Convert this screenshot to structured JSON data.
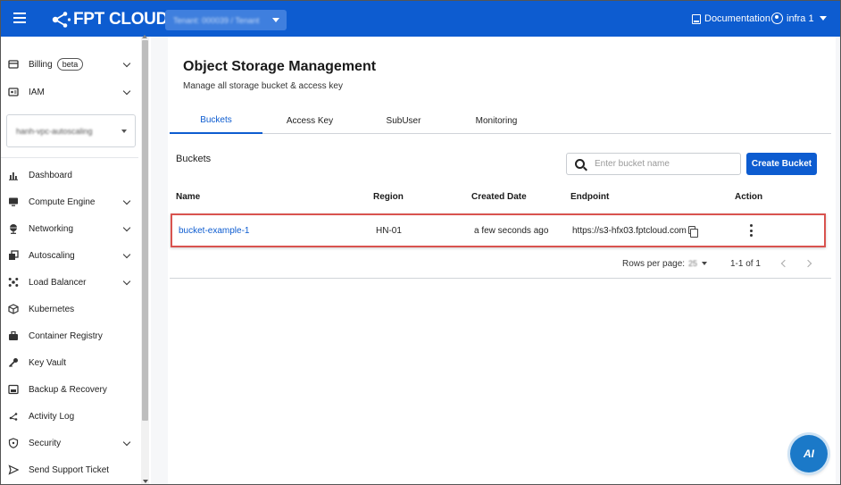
{
  "header": {
    "brand": "FPT CLOUD",
    "tenant_label": "Tenant: 000039 / Tenant",
    "documentation": "Documentation",
    "user": "infra 1"
  },
  "sidebar": {
    "top_items": [
      {
        "label": "Billing",
        "badge": "beta",
        "icon": "billing-icon",
        "expandable": true
      },
      {
        "label": "IAM",
        "icon": "iam-icon",
        "expandable": true
      }
    ],
    "vpc_select": "hanh-vpc-autoscaling",
    "items": [
      {
        "label": "Dashboard",
        "icon": "dashboard-icon",
        "expandable": false
      },
      {
        "label": "Compute Engine",
        "icon": "monitor-icon",
        "expandable": true
      },
      {
        "label": "Networking",
        "icon": "globe-icon",
        "expandable": true
      },
      {
        "label": "Autoscaling",
        "icon": "autoscaling-icon",
        "expandable": true
      },
      {
        "label": "Load Balancer",
        "icon": "load-balancer-icon",
        "expandable": true
      },
      {
        "label": "Kubernetes",
        "icon": "cube-icon",
        "expandable": false
      },
      {
        "label": "Container Registry",
        "icon": "registry-icon",
        "expandable": false
      },
      {
        "label": "Key Vault",
        "icon": "key-icon",
        "expandable": false
      },
      {
        "label": "Backup & Recovery",
        "icon": "backup-icon",
        "expandable": false
      },
      {
        "label": "Activity Log",
        "icon": "activity-icon",
        "expandable": false
      },
      {
        "label": "Security",
        "icon": "shield-icon",
        "expandable": true
      },
      {
        "label": "Send Support Ticket",
        "icon": "send-icon",
        "expandable": false
      }
    ]
  },
  "main": {
    "title": "Object Storage Management",
    "subtitle": "Manage all storage bucket & access key",
    "tabs": [
      "Buckets",
      "Access Key",
      "SubUser",
      "Monitoring"
    ],
    "active_tab": "Buckets",
    "section_title": "Buckets",
    "search_placeholder": "Enter bucket name",
    "create_button": "Create Bucket",
    "table": {
      "headers": [
        "Name",
        "Region",
        "Created Date",
        "Endpoint",
        "Action"
      ],
      "rows": [
        {
          "name": "bucket-example-1",
          "region": "HN-01",
          "created": "a few seconds ago",
          "endpoint": "https://s3-hfx03.fptcloud.com"
        }
      ]
    },
    "pagination": {
      "rows_per_page_label": "Rows per page:",
      "rows_per_page_value": "25",
      "range": "1-1 of 1"
    }
  },
  "ai_button": "AI",
  "colors": {
    "primary": "#0d5cd0",
    "highlight_border": "#d9534f"
  }
}
